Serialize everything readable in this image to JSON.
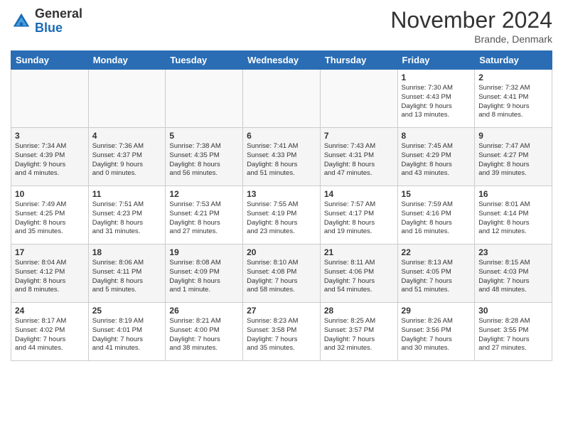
{
  "header": {
    "logo_general": "General",
    "logo_blue": "Blue",
    "month_title": "November 2024",
    "location": "Brande, Denmark"
  },
  "weekdays": [
    "Sunday",
    "Monday",
    "Tuesday",
    "Wednesday",
    "Thursday",
    "Friday",
    "Saturday"
  ],
  "weeks": [
    [
      {
        "day": "",
        "info": ""
      },
      {
        "day": "",
        "info": ""
      },
      {
        "day": "",
        "info": ""
      },
      {
        "day": "",
        "info": ""
      },
      {
        "day": "",
        "info": ""
      },
      {
        "day": "1",
        "info": "Sunrise: 7:30 AM\nSunset: 4:43 PM\nDaylight: 9 hours\nand 13 minutes."
      },
      {
        "day": "2",
        "info": "Sunrise: 7:32 AM\nSunset: 4:41 PM\nDaylight: 9 hours\nand 8 minutes."
      }
    ],
    [
      {
        "day": "3",
        "info": "Sunrise: 7:34 AM\nSunset: 4:39 PM\nDaylight: 9 hours\nand 4 minutes."
      },
      {
        "day": "4",
        "info": "Sunrise: 7:36 AM\nSunset: 4:37 PM\nDaylight: 9 hours\nand 0 minutes."
      },
      {
        "day": "5",
        "info": "Sunrise: 7:38 AM\nSunset: 4:35 PM\nDaylight: 8 hours\nand 56 minutes."
      },
      {
        "day": "6",
        "info": "Sunrise: 7:41 AM\nSunset: 4:33 PM\nDaylight: 8 hours\nand 51 minutes."
      },
      {
        "day": "7",
        "info": "Sunrise: 7:43 AM\nSunset: 4:31 PM\nDaylight: 8 hours\nand 47 minutes."
      },
      {
        "day": "8",
        "info": "Sunrise: 7:45 AM\nSunset: 4:29 PM\nDaylight: 8 hours\nand 43 minutes."
      },
      {
        "day": "9",
        "info": "Sunrise: 7:47 AM\nSunset: 4:27 PM\nDaylight: 8 hours\nand 39 minutes."
      }
    ],
    [
      {
        "day": "10",
        "info": "Sunrise: 7:49 AM\nSunset: 4:25 PM\nDaylight: 8 hours\nand 35 minutes."
      },
      {
        "day": "11",
        "info": "Sunrise: 7:51 AM\nSunset: 4:23 PM\nDaylight: 8 hours\nand 31 minutes."
      },
      {
        "day": "12",
        "info": "Sunrise: 7:53 AM\nSunset: 4:21 PM\nDaylight: 8 hours\nand 27 minutes."
      },
      {
        "day": "13",
        "info": "Sunrise: 7:55 AM\nSunset: 4:19 PM\nDaylight: 8 hours\nand 23 minutes."
      },
      {
        "day": "14",
        "info": "Sunrise: 7:57 AM\nSunset: 4:17 PM\nDaylight: 8 hours\nand 19 minutes."
      },
      {
        "day": "15",
        "info": "Sunrise: 7:59 AM\nSunset: 4:16 PM\nDaylight: 8 hours\nand 16 minutes."
      },
      {
        "day": "16",
        "info": "Sunrise: 8:01 AM\nSunset: 4:14 PM\nDaylight: 8 hours\nand 12 minutes."
      }
    ],
    [
      {
        "day": "17",
        "info": "Sunrise: 8:04 AM\nSunset: 4:12 PM\nDaylight: 8 hours\nand 8 minutes."
      },
      {
        "day": "18",
        "info": "Sunrise: 8:06 AM\nSunset: 4:11 PM\nDaylight: 8 hours\nand 5 minutes."
      },
      {
        "day": "19",
        "info": "Sunrise: 8:08 AM\nSunset: 4:09 PM\nDaylight: 8 hours\nand 1 minute."
      },
      {
        "day": "20",
        "info": "Sunrise: 8:10 AM\nSunset: 4:08 PM\nDaylight: 7 hours\nand 58 minutes."
      },
      {
        "day": "21",
        "info": "Sunrise: 8:11 AM\nSunset: 4:06 PM\nDaylight: 7 hours\nand 54 minutes."
      },
      {
        "day": "22",
        "info": "Sunrise: 8:13 AM\nSunset: 4:05 PM\nDaylight: 7 hours\nand 51 minutes."
      },
      {
        "day": "23",
        "info": "Sunrise: 8:15 AM\nSunset: 4:03 PM\nDaylight: 7 hours\nand 48 minutes."
      }
    ],
    [
      {
        "day": "24",
        "info": "Sunrise: 8:17 AM\nSunset: 4:02 PM\nDaylight: 7 hours\nand 44 minutes."
      },
      {
        "day": "25",
        "info": "Sunrise: 8:19 AM\nSunset: 4:01 PM\nDaylight: 7 hours\nand 41 minutes."
      },
      {
        "day": "26",
        "info": "Sunrise: 8:21 AM\nSunset: 4:00 PM\nDaylight: 7 hours\nand 38 minutes."
      },
      {
        "day": "27",
        "info": "Sunrise: 8:23 AM\nSunset: 3:58 PM\nDaylight: 7 hours\nand 35 minutes."
      },
      {
        "day": "28",
        "info": "Sunrise: 8:25 AM\nSunset: 3:57 PM\nDaylight: 7 hours\nand 32 minutes."
      },
      {
        "day": "29",
        "info": "Sunrise: 8:26 AM\nSunset: 3:56 PM\nDaylight: 7 hours\nand 30 minutes."
      },
      {
        "day": "30",
        "info": "Sunrise: 8:28 AM\nSunset: 3:55 PM\nDaylight: 7 hours\nand 27 minutes."
      }
    ]
  ]
}
